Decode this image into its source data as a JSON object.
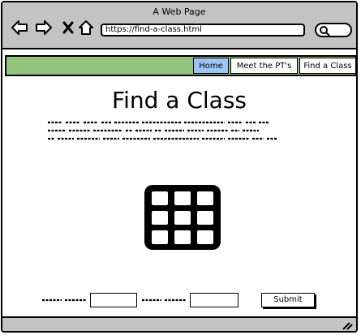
{
  "window": {
    "title": "A Web Page",
    "url": "https://find-a-class.html"
  },
  "toolbar": {
    "icons": [
      "back-arrow-icon",
      "forward-arrow-icon",
      "close-x-icon",
      "home-icon"
    ]
  },
  "nav": {
    "color": "#93c47d",
    "active_color": "#9fc5f8",
    "tabs": [
      {
        "label": "Home",
        "active": true
      },
      {
        "label": "Meet the PT's",
        "active": false
      },
      {
        "label": "Find a Class",
        "active": false
      }
    ]
  },
  "main": {
    "heading": "Find a Class"
  },
  "form": {
    "submit_label": "Submit"
  }
}
